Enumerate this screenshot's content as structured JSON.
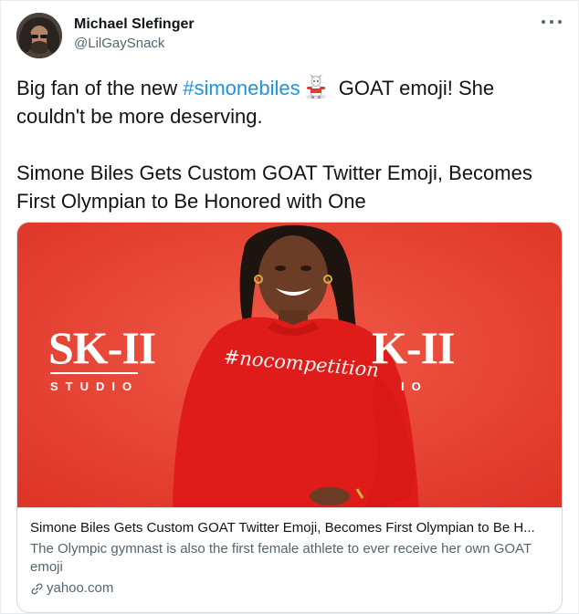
{
  "user": {
    "display_name": "Michael Slefinger",
    "handle": "@LilGaySnack"
  },
  "more_icon": "ellipsis-icon",
  "tweet": {
    "text_before": "Big fan of the new ",
    "hashtag": "#simonebiles",
    "emoji": "goat-emoji",
    "text_after": " GOAT emoji! She couldn't be more deserving.",
    "headline": "Simone Biles Gets Custom GOAT Twitter Emoji, Becomes First Olympian to Be Honored with One"
  },
  "card": {
    "title": "Simone Biles Gets Custom GOAT Twitter Emoji, Becomes First Olympian to Be H...",
    "description": "The Olympic gymnast is also the first female athlete to ever receive her own GOAT emoji",
    "domain": "yahoo.com",
    "domain_icon": "link-icon",
    "image": {
      "logo_left": "SK-II",
      "studio_left": "STUDIO",
      "logo_right": "K-II",
      "studio_right": "IO",
      "sweater_text": "#nocompetition"
    }
  },
  "colors": {
    "hashtag": "#1b95e0",
    "backdrop_red": "#e8402f",
    "sweater_red": "#e01c1a",
    "secondary_text": "#536471"
  }
}
